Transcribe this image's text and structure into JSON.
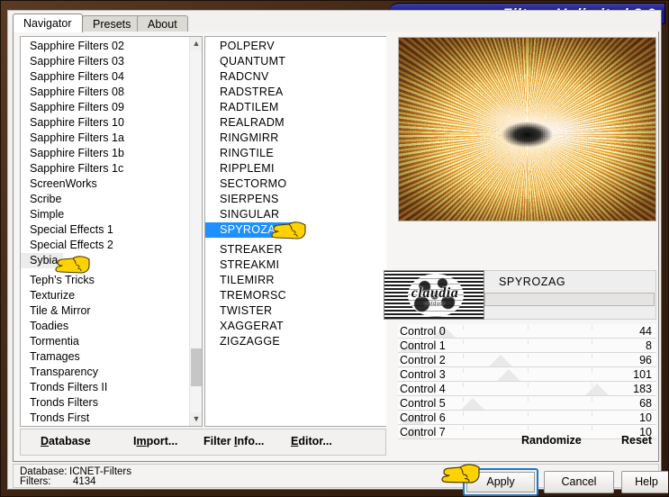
{
  "window": {
    "title": "Filters Unlimited 2.0"
  },
  "tabs": [
    {
      "label": "Navigator",
      "active": true
    },
    {
      "label": "Presets",
      "active": false
    },
    {
      "label": "About",
      "active": false
    }
  ],
  "categories": {
    "selected": "Sybia",
    "items": [
      "Sapphire Filters 02",
      "Sapphire Filters 03",
      "Sapphire Filters 04",
      "Sapphire Filters 08",
      "Sapphire Filters 09",
      "Sapphire Filters 10",
      "Sapphire Filters 1a",
      "Sapphire Filters 1b",
      "Sapphire Filters 1c",
      "ScreenWorks",
      "Scribe",
      "Simple",
      "Special Effects 1",
      "Special Effects 2",
      "Sybia",
      "Teph's Tricks",
      "Texturize",
      "Tile & Mirror",
      "Toadies",
      "Tormentia",
      "Tramages",
      "Transparency",
      "Tronds Filters II",
      "Tronds Filters",
      "Tronds First"
    ]
  },
  "filters": {
    "selected": "SPYROZAG",
    "items": [
      "POLPERV",
      "QUANTUMT",
      "RADCNV",
      "RADSTREA",
      "RADTILEM",
      "REALRADM",
      "RINGMIRR",
      "RINGTILE",
      "RIPPLEMI",
      "SECTORMO",
      "SIERPENS",
      "SINGULAR",
      "SPYROZAG",
      "STREAKER",
      "STREAKMI",
      "TILEMIRR",
      "TREMORSC",
      "TWISTER",
      "XAGGERAT",
      "ZIGZAGGE"
    ]
  },
  "logo": {
    "text": "claudia",
    "subtext": "outdoor"
  },
  "filter_name": "SPYROZAG",
  "controls": [
    {
      "name": "Control 0",
      "value": "44",
      "marker_pct": 14
    },
    {
      "name": "Control 1",
      "value": "8",
      "marker_pct": 1
    },
    {
      "name": "Control 2",
      "value": "96",
      "marker_pct": 36
    },
    {
      "name": "Control 3",
      "value": "101",
      "marker_pct": 39
    },
    {
      "name": "Control 4",
      "value": "183",
      "marker_pct": 73
    },
    {
      "name": "Control 5",
      "value": "68",
      "marker_pct": 25
    },
    {
      "name": "Control 6",
      "value": "10",
      "marker_pct": 2
    },
    {
      "name": "Control 7",
      "value": "10",
      "marker_pct": 2
    }
  ],
  "panel_menu": [
    {
      "label": "Database",
      "mnemonic": "D"
    },
    {
      "label": "Import...",
      "mnemonic": "m"
    },
    {
      "label": "Filter Info...",
      "mnemonic": "I"
    },
    {
      "label": "Editor...",
      "mnemonic": "E"
    }
  ],
  "right_actions": [
    {
      "label": "Randomize"
    },
    {
      "label": "Reset"
    }
  ],
  "status": {
    "database_label": "Database:",
    "database_value": "ICNET-Filters",
    "filters_label": "Filters:",
    "filters_value": "4134"
  },
  "dialog_buttons": {
    "apply": "Apply",
    "cancel": "Cancel",
    "help": "Help"
  },
  "colors": {
    "titlebar": "#1a1a8c",
    "selection_blue": "#1e90ff",
    "focus_border": "#1c78c8",
    "frame_brown": "#3a2211",
    "cursor_yellow": "#ffd200"
  }
}
